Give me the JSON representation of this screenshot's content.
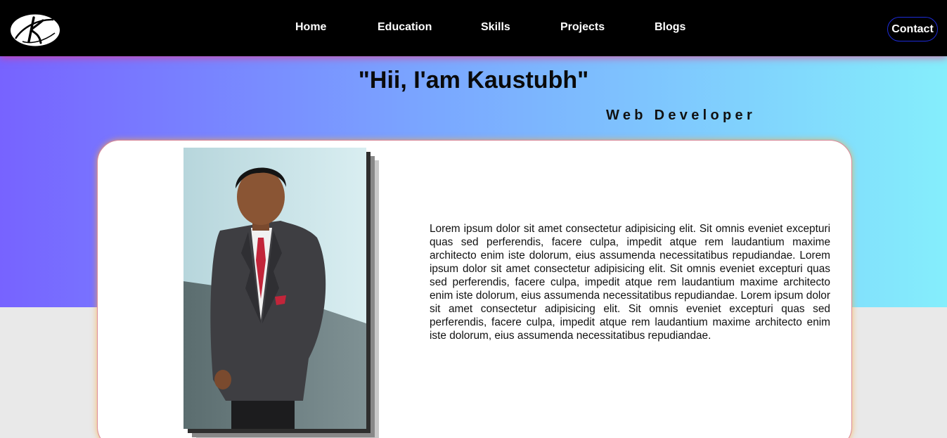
{
  "nav": {
    "logo_alt": "K",
    "links": [
      "Home",
      "Education",
      "Skills",
      "Projects",
      "Blogs"
    ],
    "contact_label": "Contact"
  },
  "hero": {
    "title": "\"Hii, I'am Kaustubh\"",
    "subtitle": "Web Developer"
  },
  "about": {
    "text": "Lorem ipsum dolor sit amet consectetur adipisicing elit. Sit omnis eveniet excepturi quas sed perferendis, facere culpa, impedit atque rem laudantium maxime architecto enim iste dolorum, eius assumenda necessitatibus repudiandae. Lorem ipsum dolor sit amet consectetur adipisicing elit. Sit omnis eveniet excepturi quas sed perferendis, facere culpa, impedit atque rem laudantium maxime architecto enim iste dolorum, eius assumenda necessitatibus repudiandae. Lorem ipsum dolor sit amet consectetur adipisicing elit. Sit omnis eveniet excepturi quas sed perferendis, facere culpa, impedit atque rem laudantium maxime architecto enim iste dolorum, eius assumenda necessitatibus repudiandae."
  },
  "colors": {
    "navbar": "#000000",
    "gradient_start": "#7763ff",
    "gradient_end": "#84eefc",
    "page_bg": "#e9e9e9",
    "contact_border": "#1d2bd8"
  }
}
